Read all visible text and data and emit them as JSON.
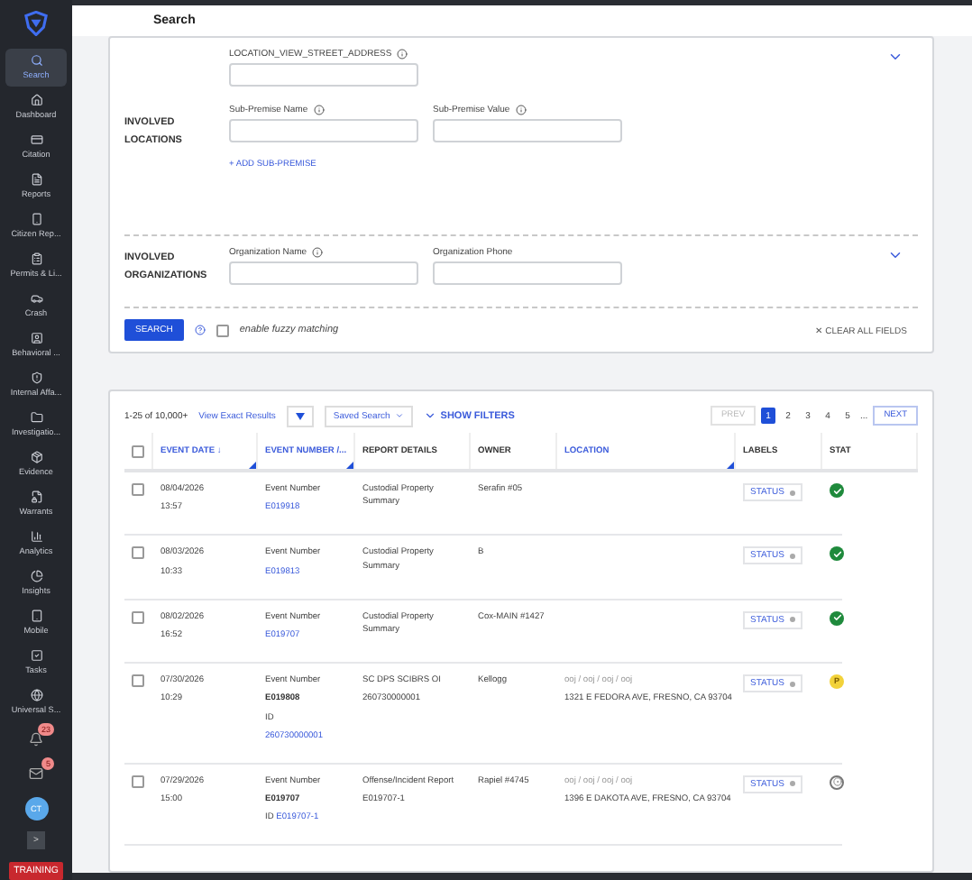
{
  "sidebar": {
    "items": [
      {
        "label": "Search",
        "selected": true
      },
      {
        "label": "Dashboard",
        "selected": false
      },
      {
        "label": "Citation",
        "selected": false
      },
      {
        "label": "Reports",
        "selected": false
      },
      {
        "label": "Citizen Rep...",
        "selected": false
      },
      {
        "label": "Permits & Li...",
        "selected": false
      },
      {
        "label": "Crash",
        "selected": false
      },
      {
        "label": "Behavioral ...",
        "selected": false
      },
      {
        "label": "Internal Affa...",
        "selected": false
      },
      {
        "label": "Investigatio...",
        "selected": false
      },
      {
        "label": "Evidence",
        "selected": false
      },
      {
        "label": "Warrants",
        "selected": false
      },
      {
        "label": "Analytics",
        "selected": false
      },
      {
        "label": "Insights",
        "selected": false
      },
      {
        "label": "Mobile",
        "selected": false
      },
      {
        "label": "Tasks",
        "selected": false
      },
      {
        "label": "Universal S...",
        "selected": false
      }
    ],
    "alerts": [
      {
        "kind": "bell",
        "count": "23"
      },
      {
        "kind": "mail",
        "count": "5"
      }
    ],
    "avatar": "CT",
    "expand": ">",
    "environment": "TRAINING"
  },
  "header": {
    "title": "Search"
  },
  "form": {
    "sections": [
      {
        "title": "INVOLVED LOCATIONS",
        "rows": [
          [
            {
              "label": "LOCATION_VIEW_STREET_ADDRESS",
              "info": true
            }
          ],
          [
            {
              "label": "Sub-Premise Name",
              "info": true
            },
            {
              "label": "Sub-Premise Value",
              "info": true
            }
          ]
        ],
        "add_link": "+ ADD SUB-PREMISE"
      },
      {
        "title": "INVOLVED ORGANIZATIONS",
        "rows": [
          [
            {
              "label": "Organization Name",
              "info": true
            },
            {
              "label": "Organization Phone",
              "info": false
            }
          ]
        ]
      }
    ],
    "search_button": "SEARCH",
    "fuzzy": {
      "label": "enable fuzzy matching",
      "checked": false
    },
    "clear": "✕ CLEAR ALL FIELDS"
  },
  "results": {
    "count": "1-25 of 10,000+",
    "view_exact": "View Exact Results",
    "saved_search": "Saved Search",
    "show_filters": "SHOW FILTERS",
    "pagination": {
      "prev": "PREV",
      "pages": [
        {
          "label": "1",
          "selected": true
        },
        {
          "label": "2",
          "selected": false
        },
        {
          "label": "3",
          "selected": false
        },
        {
          "label": "4",
          "selected": false
        },
        {
          "label": "5",
          "selected": false
        }
      ],
      "ellipsis": "...",
      "next": "NEXT"
    },
    "select_all_checked": false,
    "columns": [
      {
        "label": "EVENT DATE ↓",
        "link": true,
        "resize": true
      },
      {
        "label": "EVENT NUMBER /...",
        "link": true,
        "resize": true
      },
      {
        "label": "REPORT DETAILS",
        "link": false,
        "resize": false
      },
      {
        "label": "OWNER",
        "link": false,
        "resize": false
      },
      {
        "label": "LOCATION",
        "link": true,
        "resize": true
      },
      {
        "label": "LABELS",
        "link": false,
        "resize": false
      },
      {
        "label": "STAT",
        "link": false,
        "resize": false
      }
    ],
    "rows": [
      {
        "checked": false,
        "date": "08/04/2026",
        "time": "13:57",
        "event": [
          {
            "text": "Event Number",
            "kind": "label"
          },
          {
            "text": "E019918",
            "kind": "link"
          }
        ],
        "details": [
          "Custodial Property Summary"
        ],
        "owner": [
          "Serafin #05"
        ],
        "location": [],
        "label": "STATUS",
        "stat": {
          "kind": "check"
        }
      },
      {
        "checked": false,
        "date": "08/03/2026",
        "time": "10:33",
        "event": [
          {
            "text": "Event Number",
            "kind": "label"
          },
          {
            "text": "E019813",
            "kind": "link"
          }
        ],
        "details": [
          "Custodial Property Summary"
        ],
        "owner": [
          "B"
        ],
        "location": [],
        "label": "STATUS",
        "stat": {
          "kind": "check"
        }
      },
      {
        "checked": false,
        "date": "08/02/2026",
        "time": "16:52",
        "event": [
          {
            "text": "Event Number",
            "kind": "label"
          },
          {
            "text": "E019707",
            "kind": "link"
          }
        ],
        "details": [
          "Custodial Property Summary"
        ],
        "owner": [
          "Cox-MAIN #1427"
        ],
        "location": [],
        "label": "STATUS",
        "stat": {
          "kind": "check"
        }
      },
      {
        "checked": false,
        "date": "07/30/2026",
        "time": "10:29",
        "event": [
          {
            "text": "Event Number",
            "kind": "label"
          },
          {
            "text": "E019808",
            "kind": "bold"
          },
          {
            "text": "ID",
            "kind": "label"
          },
          {
            "text": "260730000001",
            "kind": "link"
          }
        ],
        "details": [
          "SC DPS SCIBRS OI",
          "260730000001"
        ],
        "owner": [
          "Kellogg"
        ],
        "location": [
          {
            "text": "ooj / ooj / ooj / ooj",
            "kind": "muted"
          },
          {
            "text": "1321 E FEDORA AVE, FRESNO, CA 93704",
            "kind": "address"
          }
        ],
        "label": "STATUS",
        "stat": {
          "kind": "letter",
          "text": "P"
        }
      },
      {
        "checked": false,
        "date": "07/29/2026",
        "time": "15:00",
        "event": [
          {
            "text": "Event Number",
            "kind": "label"
          },
          {
            "text": "E019707",
            "kind": "bold"
          },
          {
            "prefix": "ID",
            "text": "E019707-1",
            "kind": "link"
          }
        ],
        "details": [
          "Offense/Incident Report",
          "E019707-1"
        ],
        "owner": [
          "Rapiel #4745"
        ],
        "location": [
          {
            "text": "ooj / ooj / ooj / ooj",
            "kind": "muted"
          },
          {
            "text": "1396 E DAKOTA AVE, FRESNO, CA 93704",
            "kind": "address"
          }
        ],
        "label": "STATUS",
        "stat": {
          "kind": "pending"
        }
      }
    ]
  }
}
